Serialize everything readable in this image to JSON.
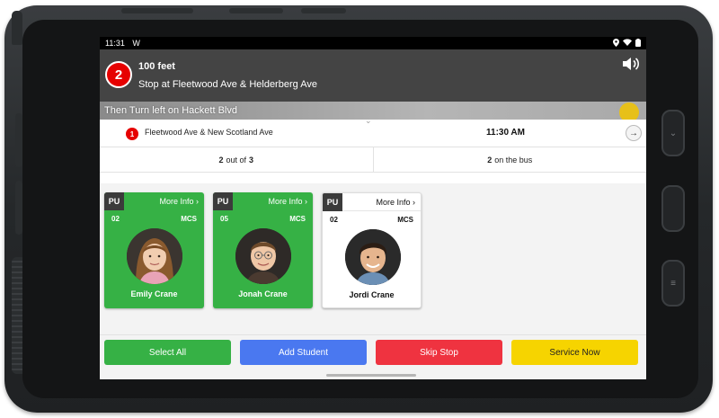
{
  "status_bar": {
    "time": "11:31",
    "notification_glyph": "W"
  },
  "navigation": {
    "step_number": "2",
    "distance": "100 feet",
    "instruction": "Stop at Fleetwood Ave & Helderberg Ave",
    "then": "Then Turn left on Hackett Blvd"
  },
  "stop": {
    "number": "1",
    "name": "Fleetwood Ave & New Scotland Ave",
    "time": "11:30 AM",
    "collapse_glyph": "⌄",
    "next_glyph": "→"
  },
  "counts": {
    "completed": "2",
    "completed_mid": "out of",
    "total": "3",
    "on_bus": "2",
    "on_bus_label": "on the bus"
  },
  "students": [
    {
      "type": "PU",
      "more_info": "More Info ›",
      "grade": "02",
      "school": "MCS",
      "name": "Emily Crane",
      "state": "selected"
    },
    {
      "type": "PU",
      "more_info": "More Info ›",
      "grade": "05",
      "school": "MCS",
      "name": "Jonah Crane",
      "state": "selected"
    },
    {
      "type": "PU",
      "more_info": "More Info ›",
      "grade": "02",
      "school": "MCS",
      "name": "Jordi Crane",
      "state": "unselected"
    }
  ],
  "actions": {
    "select_all": "Select All",
    "add_student": "Add Student",
    "skip_stop": "Skip Stop",
    "service_now": "Service Now"
  },
  "colors": {
    "selected_card": "#36b145",
    "alert_red": "#e60000",
    "add_blue": "#4a78f0",
    "skip_red": "#ef3340",
    "service_yellow": "#f6d400",
    "nav_bar": "#444444"
  }
}
